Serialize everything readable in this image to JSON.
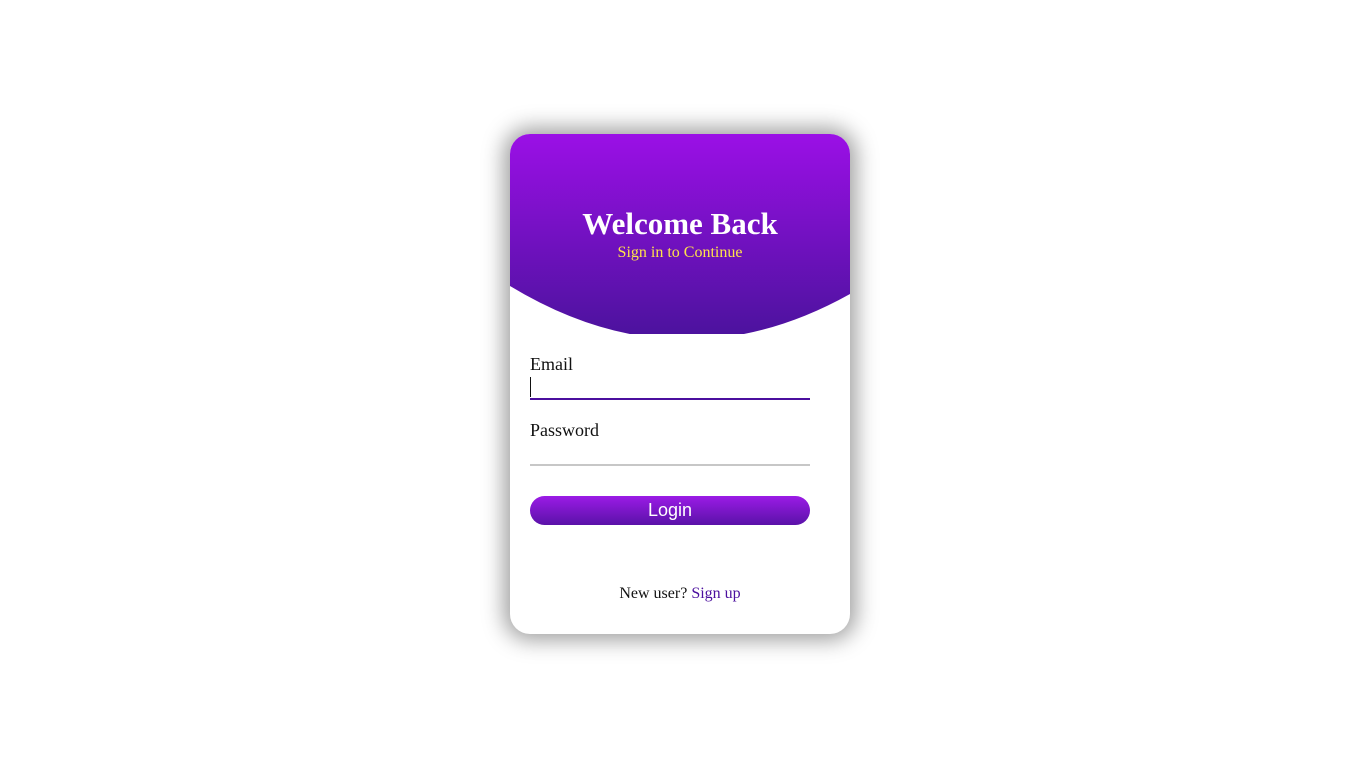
{
  "header": {
    "title": "Welcome Back",
    "subtitle": "Sign in to Continue"
  },
  "form": {
    "email_label": "Email",
    "email_value": "",
    "password_label": "Password",
    "password_value": "",
    "login_label": "Login"
  },
  "footer": {
    "prompt": "New user?",
    "signup_link": "Sign up"
  },
  "colors": {
    "gradient_top": "#9b10e6",
    "gradient_bottom": "#4a129c",
    "subtitle": "#ffe34a",
    "link": "#4b0f9e",
    "active_underline": "#4b0f9e",
    "inactive_underline": "#c7c7c7"
  }
}
